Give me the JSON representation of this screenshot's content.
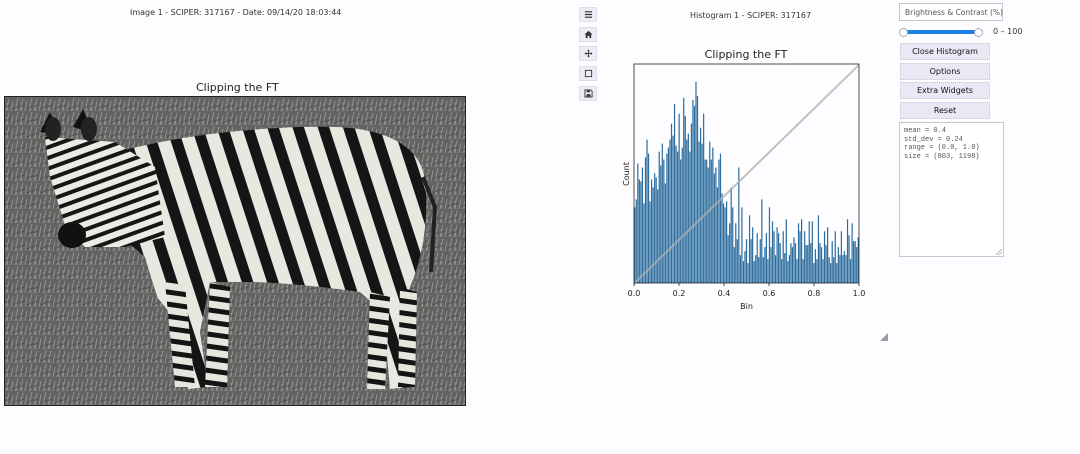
{
  "image_panel": {
    "header": "Image 1 - SCIPER: 317167 - Date: 09/14/20 18:03:44",
    "title": "Clipping the FT"
  },
  "toolbar": {
    "items": [
      {
        "name": "menu-icon"
      },
      {
        "name": "home-icon"
      },
      {
        "name": "pan-icon"
      },
      {
        "name": "zoom-rect-icon"
      },
      {
        "name": "save-icon"
      }
    ]
  },
  "histogram_panel": {
    "header": "Histogram 1 - SCIPER: 317167"
  },
  "controls": {
    "brightness_label": "Brightness & Contrast (%)",
    "slider": {
      "min_value": 0,
      "max_value": 100,
      "range_text": "0 – 100"
    },
    "buttons": {
      "close": "Close Histogram",
      "options": "Options",
      "extra": "Extra Widgets",
      "reset": "Reset"
    },
    "stats": [
      "mean = 0.4",
      "std_dev = 0.24",
      "range = (0.0, 1.0)",
      "size = (803, 1198)"
    ]
  },
  "chart_data": {
    "type": "bar",
    "title": "Clipping the FT",
    "xlabel": "Bin",
    "ylabel": "Count",
    "xlim": [
      0,
      1
    ],
    "xticks": [
      "0.0",
      "0.2",
      "0.4",
      "0.6",
      "0.8",
      "1.0"
    ],
    "bar_color": "#2e6e9e",
    "values": [
      38,
      42,
      60,
      52,
      51,
      58,
      40,
      63,
      72,
      65,
      41,
      52,
      48,
      55,
      53,
      47,
      66,
      59,
      70,
      62,
      50,
      65,
      68,
      72,
      80,
      74,
      90,
      69,
      66,
      85,
      62,
      68,
      93,
      84,
      72,
      75,
      66,
      80,
      92,
      89,
      101,
      94,
      71,
      78,
      70,
      85,
      62,
      62,
      58,
      71,
      62,
      68,
      55,
      58,
      48,
      62,
      65,
      45,
      40,
      38,
      41,
      24,
      30,
      48,
      38,
      18,
      30,
      22,
      58,
      14,
      38,
      11,
      16,
      22,
      10,
      34,
      22,
      28,
      11,
      14,
      25,
      13,
      22,
      42,
      13,
      18,
      25,
      12,
      38,
      18,
      31,
      26,
      14,
      28,
      25,
      20,
      12,
      26,
      15,
      32,
      11,
      14,
      20,
      18,
      23,
      20,
      12,
      30,
      26,
      32,
      12,
      26,
      19,
      19,
      31,
      20,
      31,
      10,
      17,
      12,
      34,
      20,
      18,
      12,
      26,
      19,
      28,
      13,
      10,
      21,
      13,
      26,
      10,
      18,
      14,
      26,
      14,
      16,
      14,
      32,
      24,
      12,
      30,
      21,
      21,
      18,
      23
    ],
    "annotations": [
      {
        "type": "line",
        "color": "#c8b98a",
        "from": [
          0,
          0
        ],
        "to": [
          1,
          1
        ]
      },
      {
        "type": "line",
        "color": "#9aa7d6",
        "from": [
          0,
          0
        ],
        "to": [
          1,
          1
        ]
      }
    ]
  }
}
